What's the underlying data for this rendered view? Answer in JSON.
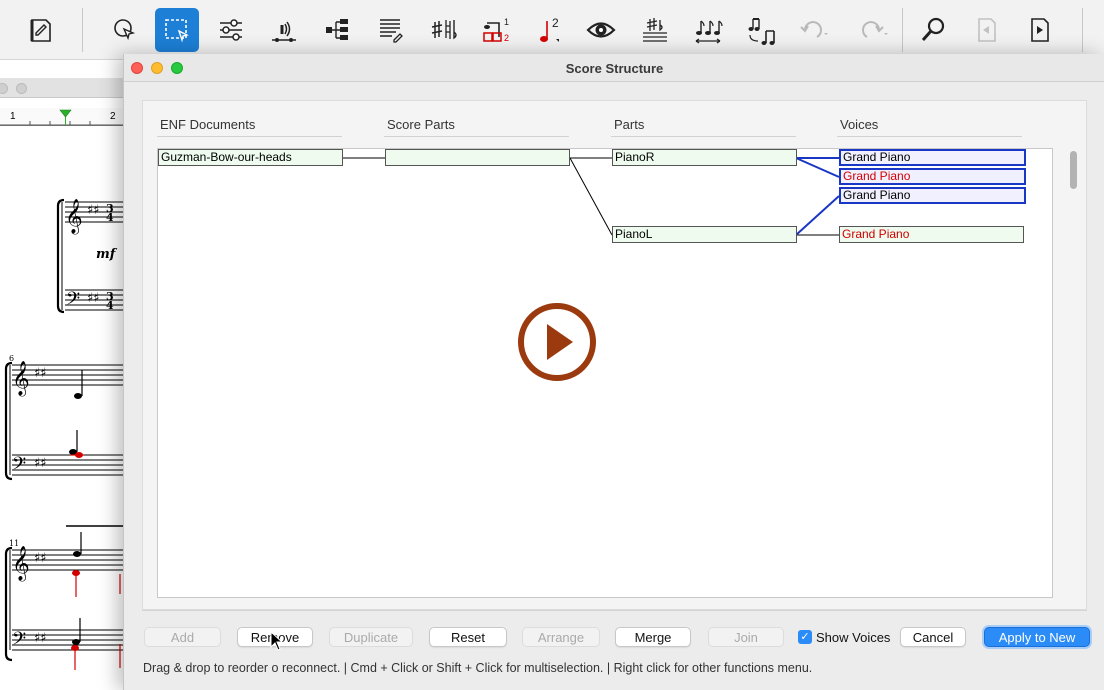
{
  "toolbar": {
    "items": [
      {
        "icon": "document-edit-icon"
      },
      {
        "icon": "pointer-tool-icon"
      },
      {
        "icon": "selection-tool-icon",
        "active": true
      },
      {
        "icon": "mixer-sliders-icon"
      },
      {
        "icon": "sound-playback-icon"
      },
      {
        "icon": "score-structure-icon"
      },
      {
        "icon": "page-text-icon"
      },
      {
        "icon": "accidentals-icon"
      },
      {
        "icon": "voice-numbers-icon"
      },
      {
        "icon": "note-voice-2-icon"
      },
      {
        "icon": "eye-icon"
      },
      {
        "icon": "key-signature-icon"
      },
      {
        "icon": "note-spacing-icon"
      },
      {
        "icon": "rhythm-transform-icon"
      },
      {
        "icon": "undo-icon",
        "disabled": true
      },
      {
        "icon": "redo-icon",
        "disabled": true
      },
      {
        "icon": "zoom-icon"
      },
      {
        "icon": "previous-page-icon",
        "disabled": true
      },
      {
        "icon": "next-page-icon"
      }
    ]
  },
  "score": {
    "ruler_marks": [
      "1",
      "2"
    ],
    "dynamic": "mf",
    "measure_numbers": [
      "6",
      "11"
    ]
  },
  "dialog": {
    "title": "Score Structure",
    "columns": [
      "ENF Documents",
      "Score Parts",
      "Parts",
      "Voices"
    ],
    "enf_document": "Guzman-Bow-our-heads",
    "score_part": "",
    "parts": [
      "PianoR",
      "PianoL"
    ],
    "voices": [
      {
        "label": "Grand Piano",
        "color": "#000000",
        "selected": true
      },
      {
        "label": "Grand Piano",
        "color": "#d20000",
        "selected": true
      },
      {
        "label": "Grand Piano",
        "color": "#000000",
        "selected": true
      },
      {
        "label": "Grand Piano",
        "color": "#d20000",
        "selected": false
      }
    ],
    "buttons": {
      "add": "Add",
      "remove": "Remove",
      "duplicate": "Duplicate",
      "reset": "Reset",
      "arrange": "Arrange",
      "merge": "Merge",
      "join": "Join",
      "cancel": "Cancel",
      "apply": "Apply to New"
    },
    "show_voices": {
      "label": "Show Voices",
      "checked": true
    },
    "status": "Drag & drop to reorder o reconnect. | Cmd + Click or Shift + Click for multiselection. | Right click for other functions menu."
  },
  "colors": {
    "accent": "#1d7fd6",
    "node_fill": "#eefbee",
    "selection_border": "#1a36c4",
    "voice_red": "#d20000",
    "play_overlay": "#9b3a0e"
  }
}
